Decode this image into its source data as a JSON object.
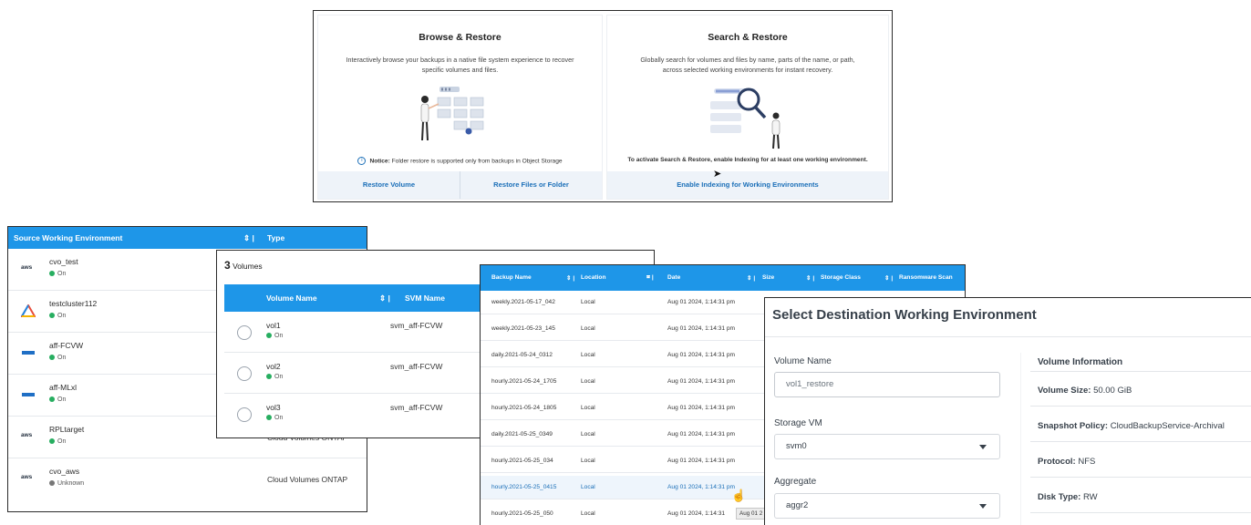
{
  "restore": {
    "browse": {
      "title": "Browse & Restore",
      "description": "Interactively browse your backups in a native file system experience to recover specific volumes and files.",
      "notice_label": "Notice:",
      "notice_text": "Folder restore is supported only from backups in Object Storage",
      "actions": [
        "Restore Volume",
        "Restore Files or Folder"
      ]
    },
    "search": {
      "title": "Search & Restore",
      "description": "Globally search for volumes and files by name, parts of the name, or path, across selected working environments for instant recovery.",
      "notice_text": "To activate Search & Restore, enable Indexing for at least one working environment.",
      "action": "Enable Indexing for Working Environments"
    }
  },
  "source_table": {
    "columns": [
      "Source Working Environment",
      "Type"
    ],
    "rows": [
      {
        "logo": "aws",
        "name": "cvo_test",
        "status": "On",
        "type": ""
      },
      {
        "logo": "cloud-triangle-icon",
        "name": "testcluster112",
        "status": "On",
        "type": ""
      },
      {
        "logo": "aff-bar-icon",
        "name": "aff-FCVW",
        "status": "On",
        "type": ""
      },
      {
        "logo": "aff-bar-icon",
        "name": "aff-MLxl",
        "status": "On",
        "type": ""
      },
      {
        "logo": "aws",
        "name": "RPLtarget",
        "status": "On",
        "type": "Cloud Volumes ONTAP"
      },
      {
        "logo": "aws",
        "name": "cvo_aws",
        "status": "Unknown",
        "type": "Cloud Volumes ONTAP"
      }
    ]
  },
  "volumes": {
    "count": "3",
    "count_label": "Volumes",
    "columns": [
      "Volume Name",
      "SVM Name"
    ],
    "rows": [
      {
        "name": "vol1",
        "status": "On",
        "svm": "svm_aff-FCVW"
      },
      {
        "name": "vol2",
        "status": "On",
        "svm": "svm_aff-FCVW"
      },
      {
        "name": "vol3",
        "status": "On",
        "svm": "svm_aff-FCVW"
      }
    ]
  },
  "backups": {
    "columns": [
      "Backup Name",
      "Location",
      "Date",
      "Size",
      "Storage Class",
      "Ransomware Scan"
    ],
    "rows": [
      {
        "name": "weekly.2021-05-17_042",
        "location": "Local",
        "date": "Aug 01 2024, 1:14:31 pm"
      },
      {
        "name": "weekly.2021-05-23_145",
        "location": "Local",
        "date": "Aug 01 2024, 1:14:31 pm"
      },
      {
        "name": "daily.2021-05-24_0312",
        "location": "Local",
        "date": "Aug 01 2024, 1:14:31 pm"
      },
      {
        "name": "hourly.2021-05-24_1705",
        "location": "Local",
        "date": "Aug 01 2024, 1:14:31 pm"
      },
      {
        "name": "hourly.2021-05-24_1805",
        "location": "Local",
        "date": "Aug 01 2024, 1:14:31 pm"
      },
      {
        "name": "daily.2021-05-25_0349",
        "location": "Local",
        "date": "Aug 01 2024, 1:14:31 pm"
      },
      {
        "name": "hourly.2021-05-25_034",
        "location": "Local",
        "date": "Aug 01 2024, 1:14:31 pm"
      },
      {
        "name": "hourly.2021-05-25_0415",
        "location": "Local",
        "date": "Aug 01 2024, 1:14:31 pm"
      },
      {
        "name": "hourly.2021-05-25_050",
        "location": "Local",
        "date": "Aug 01 2024, 1:14:31"
      }
    ],
    "tooltip": "Aug 01 2"
  },
  "destination": {
    "title": "Select Destination Working Environment",
    "volume_name_label": "Volume Name",
    "volume_name_value": "vol1_restore",
    "storage_vm_label": "Storage VM",
    "storage_vm_value": "svm0",
    "aggregate_label": "Aggregate",
    "aggregate_value": "aggr2",
    "info_heading": "Volume Information",
    "info": [
      {
        "label": "Volume Size:",
        "value": "50.00 GiB"
      },
      {
        "label": "Snapshot Policy:",
        "value": "CloudBackupService-Archival"
      },
      {
        "label": "Protocol:",
        "value": "NFS"
      },
      {
        "label": "Disk Type:",
        "value": "RW"
      }
    ]
  },
  "colors": {
    "header_blue": "#1e96e8",
    "link_blue": "#1b6fb8",
    "status_on": "#27ae60",
    "status_unknown": "#777777"
  }
}
